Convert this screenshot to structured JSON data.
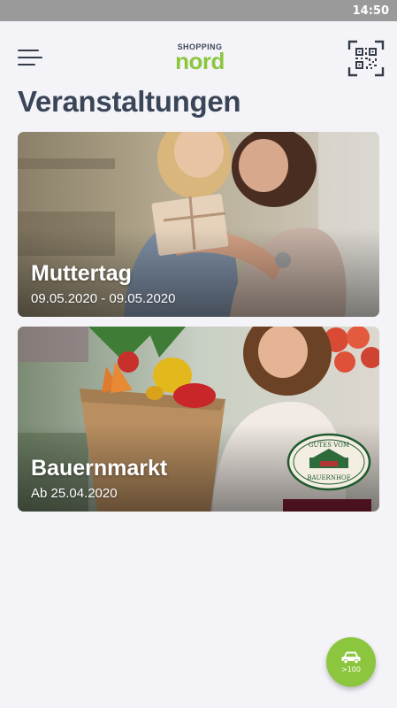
{
  "status_bar": {
    "time": "14:50"
  },
  "header": {
    "logo_top": "SHOPPING",
    "logo_main": "nord",
    "menu_icon": "hamburger-menu-icon",
    "qr_icon": "qr-code-scan-icon"
  },
  "page": {
    "title": "Veranstaltungen"
  },
  "events": [
    {
      "title": "Muttertag",
      "date": "09.05.2020 - 09.05.2020"
    },
    {
      "title": "Bauernmarkt",
      "date": "Ab 25.04.2020"
    }
  ],
  "fab": {
    "icon": "car-icon",
    "label": ">100"
  },
  "colors": {
    "accent": "#8cc63f",
    "title": "#3a4658",
    "background": "#f4f3f8"
  }
}
